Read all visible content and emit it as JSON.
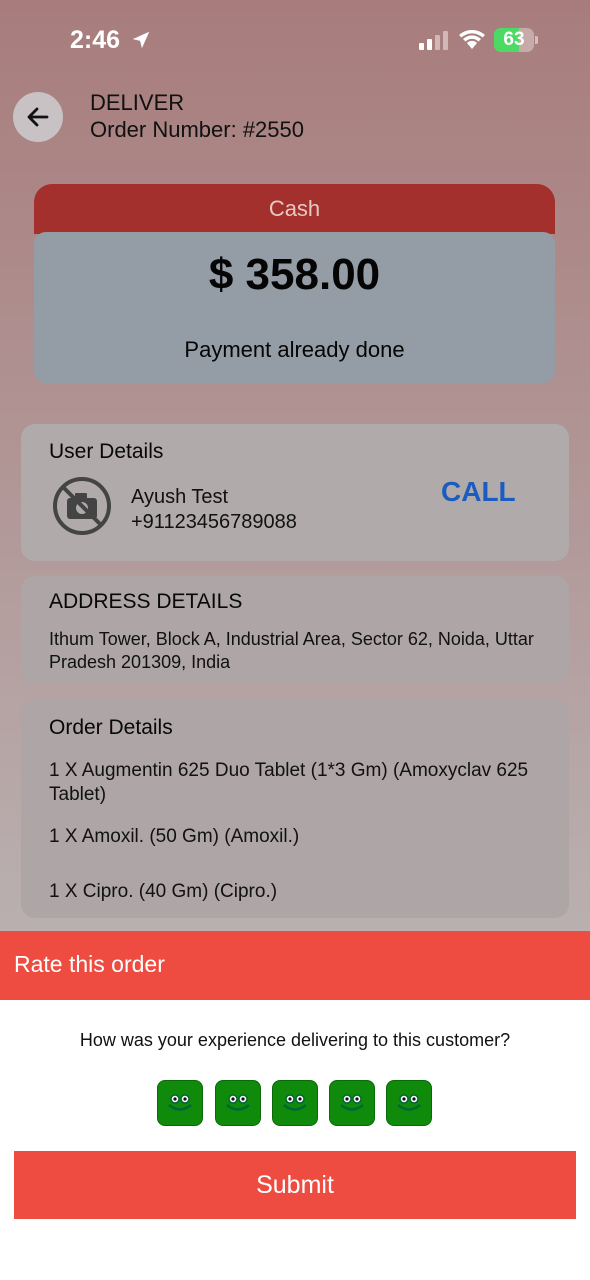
{
  "status_bar": {
    "time": "2:46",
    "battery": "63",
    "battery_level": 0.63,
    "icons": [
      "location-arrow-icon",
      "cellular-signal-icon",
      "wifi-icon",
      "battery-charging-icon"
    ]
  },
  "header": {
    "back_icon": "arrow-left-icon",
    "title": "DELIVER",
    "order_number": "Order Number: #2550"
  },
  "payment": {
    "method": "Cash",
    "amount": "$ 358.00",
    "status": "Payment already done",
    "colors": {
      "tab": "#a3302d",
      "card": "#949ca6"
    }
  },
  "user_details": {
    "title": "User Details",
    "avatar_icon": "no-photo-icon",
    "name": "Ayush Test",
    "phone": "+91123456789088",
    "call_label": "CALL",
    "call_color": "#1a5cc0"
  },
  "address_details": {
    "title": "ADDRESS DETAILS",
    "text": "Ithum Tower, Block A, Industrial Area, Sector 62, Noida, Uttar Pradesh 201309, India"
  },
  "order_details": {
    "title": "Order Details",
    "items": [
      "1 X Augmentin 625 Duo Tablet (1*3 Gm) (Amoxyclav 625 Tablet)",
      "1 X Amoxil. (50 Gm) (Amoxil.)",
      "1 X Cipro. (40 Gm) (Cipro.)"
    ]
  },
  "rating": {
    "title": "Rate this order",
    "question": "How was your experience delivering to this customer?",
    "star_icon": "smiley-face-icon",
    "star_count": 5,
    "submit_label": "Submit",
    "accent": "#ee4c40"
  }
}
